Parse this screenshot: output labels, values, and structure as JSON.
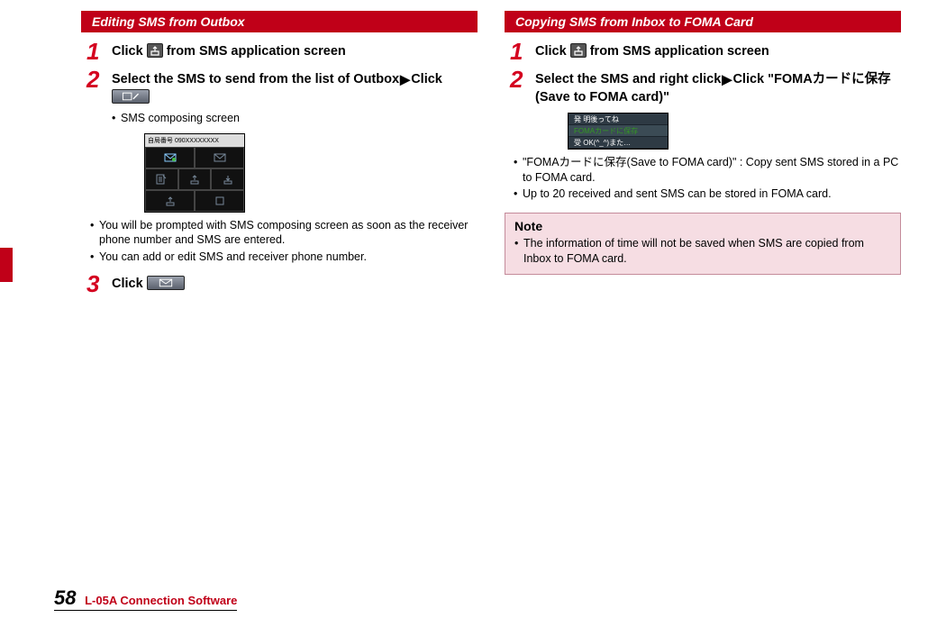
{
  "left": {
    "header": "Editing SMS from Outbox",
    "step1": {
      "num": "1",
      "pre": "Click ",
      "post": " from SMS application screen"
    },
    "step2": {
      "num": "2",
      "title_a": "Select the SMS to send from the list of Outbox",
      "title_b": "Click ",
      "bullet1": "SMS composing screen",
      "mock_top": "自局番号  090XXXXXXXX",
      "bullet2": "You will be prompted with SMS composing screen as soon as the receiver phone number and SMS are entered.",
      "bullet3": "You can add or edit SMS and receiver phone number."
    },
    "step3": {
      "num": "3",
      "title": "Click "
    }
  },
  "right": {
    "header": "Copying SMS from Inbox to FOMA Card",
    "step1": {
      "num": "1",
      "pre": "Click ",
      "post": " from SMS application screen"
    },
    "step2": {
      "num": "2",
      "title_a": "Select the SMS and right click",
      "title_b": "Click \"FOMAカードに保存(Save to FOMA card)\"",
      "mock_row1": "発  明後ってね",
      "mock_row2": "FOMAカードに保存",
      "mock_row3": "受  OK(^_^)また…",
      "bullet1": "\"FOMAカードに保存(Save to FOMA card)\" : Copy sent SMS stored in a PC to FOMA card.",
      "bullet2": "Up to 20 received and sent SMS can be stored in FOMA card."
    },
    "note": {
      "title": "Note",
      "item": "The information of time will not be saved when SMS are copied from Inbox to FOMA card."
    }
  },
  "footer": {
    "page": "58",
    "text": "L-05A Connection Software"
  }
}
